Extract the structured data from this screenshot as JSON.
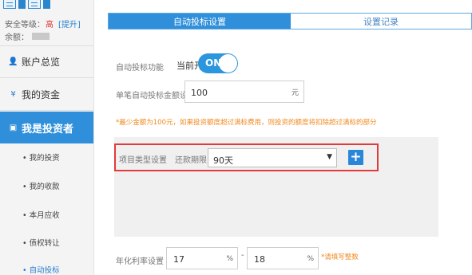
{
  "sidebar": {
    "safety_label": "安全等级：",
    "safety_level": "高",
    "upgrade_link": "[提升]",
    "balance_label": "余额：",
    "nav": {
      "overview": "账户总览",
      "funds": "我的资金",
      "investor": "我是投资者"
    },
    "sub_items": [
      "• 我的投资",
      "• 我的收款",
      "• 本月应收",
      "• 债权转让",
      "• 自动投标"
    ]
  },
  "tabs": {
    "auto_bid": "自动投标设置",
    "records": "设置记录"
  },
  "form": {
    "auto_bid_label": "自动投标功能",
    "status_text": "当前开启",
    "toggle_label": "ON",
    "amount_label": "单笔自动投标金额设置",
    "amount_value": "100",
    "amount_unit": "元",
    "notice": "*最少金额为100元，如果投资额度超过满标费用，则投资的额度将扣除超过满标的部分",
    "project_type_label": "项目类型设置",
    "term_label": "还款期限",
    "term_selected": "90天",
    "add_symbol": "+",
    "rate_label": "年化利率设置",
    "rate_min": "17",
    "rate_max": "18",
    "rate_unit": "%",
    "rate_sep": "-",
    "rate_hint": "*请填写整数"
  },
  "colors": {
    "accent": "#2f8fda",
    "warning": "#f08a20",
    "danger": "#e23a3a"
  }
}
